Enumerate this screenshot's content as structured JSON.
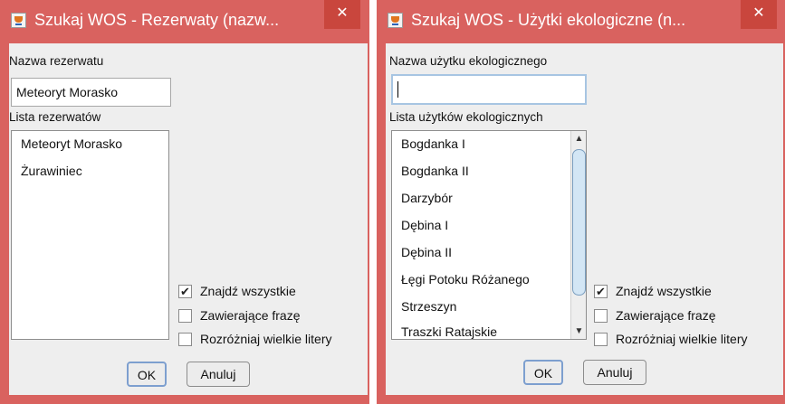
{
  "left_dialog": {
    "title": "Szukaj WOS - Rezerwaty (nazw...",
    "close_glyph": "✕",
    "name_label": "Nazwa rezerwatu",
    "name_value": "Meteoryt Morasko",
    "list_label": "Lista rezerwatów",
    "list_items": [
      "Meteoryt Morasko",
      "Żurawiniec"
    ],
    "options": [
      {
        "label": "Znajdź wszystkie",
        "checked": true
      },
      {
        "label": "Zawierające frazę",
        "checked": false
      },
      {
        "label": "Rozróżniaj wielkie litery",
        "checked": false
      }
    ],
    "ok_label": "OK",
    "cancel_label": "Anuluj"
  },
  "right_dialog": {
    "title": "Szukaj WOS - Użytki ekologiczne (n...",
    "close_glyph": "✕",
    "name_label": "Nazwa użytku ekologicznego",
    "name_value": "",
    "list_label": "Lista użytków ekologicznych",
    "list_items": [
      "Bogdanka I",
      "Bogdanka II",
      "Darzybór",
      "Dębina I",
      "Dębina II",
      "Łęgi Potoku Różanego",
      "Strzeszyn",
      "Traszki Ratajskie"
    ],
    "options": [
      {
        "label": "Znajdź wszystkie",
        "checked": true
      },
      {
        "label": "Zawierające frazę",
        "checked": false
      },
      {
        "label": "Rozróżniaj wielkie litery",
        "checked": false
      }
    ],
    "ok_label": "OK",
    "cancel_label": "Anuluj",
    "scroll_up_glyph": "▲",
    "scroll_down_glyph": "▼"
  },
  "check_glyph": "✔"
}
